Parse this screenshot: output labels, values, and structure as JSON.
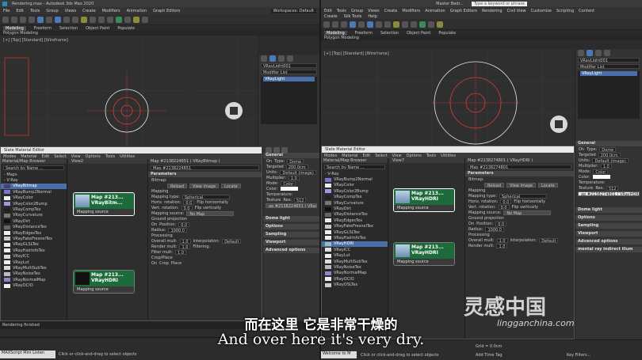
{
  "left": {
    "title": "Rendering.max - Autodesk 3ds Max 2020",
    "menu": [
      "File",
      "Edit",
      "Tools",
      "Group",
      "Views",
      "Create",
      "Modifiers",
      "Animation",
      "Graph Editors"
    ],
    "workspace": "Workspaces: Default",
    "tabs": [
      "Modeling",
      "Freeform",
      "Selection",
      "Object Paint",
      "Populate"
    ],
    "subtab": "Polygon Modeling",
    "viewport_label": "[+] [Top] [Standard] [Wireframe]",
    "cmd": {
      "name": "VRayLight001",
      "modifier_list": "Modifier List",
      "stack_item": "VRayLight"
    },
    "sme": {
      "title": "Slate Material Editor",
      "menu": [
        "Modes",
        "Material",
        "Edit",
        "Select",
        "View",
        "Options",
        "Tools",
        "Utilities"
      ],
      "browser_title": "Material/Map Browser",
      "search": "Search by Name ...",
      "group_maps": "- Maps",
      "group_vray": "- V-Ray",
      "items": [
        "VRayBitmap",
        "VRayBump2Normal",
        "VRayColor",
        "VRayColor2Bump",
        "VRayCompTex",
        "VRayCurvature",
        "VRayDirt",
        "VRayDistanceTex",
        "VRayEdgesTex",
        "VRayFakeFresnelTex",
        "VRayGLSLTex",
        "VRayHairInfoTex",
        "VRayICC",
        "VRayLut",
        "VRayMultiSubTex",
        "VRayNoiseTex",
        "VRayNormalMap",
        "VRayOCIO"
      ],
      "view_tab": "View1",
      "view_tab2": "View2",
      "node1": {
        "title": "Map #213...",
        "type": "VRayBitm...",
        "socket": "Mapping source"
      },
      "node2": {
        "title": "Map #213...",
        "type": "VRayHDRI",
        "socket": "Mapping source"
      },
      "param_title": "Map #2138224651  ( VRayBitmap )",
      "param_sub": "Map #2138224651",
      "sections": {
        "parameters": "Parameters",
        "bitmap": "Bitmap:",
        "reload": "Reload",
        "view_image": "View image",
        "locate": "Locate",
        "mapping": "Mapping",
        "mapping_type": "Mapping type:",
        "spherical": "Spherical",
        "horiz": "Horiz. rotation:",
        "vert": "Vert. rotation:",
        "flip_h": "Flip horizontally",
        "flip_v": "Flip vertically",
        "mapping_source": "Mapping source:",
        "no_map": "No Map",
        "ground": "Ground projection",
        "on": "On",
        "position": "Position:",
        "radius": "Radius:",
        "radius_val": "1000.0",
        "processing": "Processing",
        "overall": "Overall mult:",
        "render": "Render mult:",
        "interp": "Interpolation:",
        "default": "Default",
        "filter": "Filter mult:",
        "filtering": "Filtering:",
        "crop": "Crop/Place",
        "crop_opt": "Crop",
        "place_opt": "Place",
        "zero": "0.0",
        "one": "1.0"
      }
    },
    "light_panel": {
      "general": "General",
      "on": "On",
      "type_label": "Type:",
      "type": "Dome",
      "targeted": "Targeted",
      "length": "200.0cm",
      "units": "Units:",
      "units_val": "Default (image)",
      "multiplier": "Multiplier:",
      "multiplier_val": "1.0",
      "mode": "Mode:",
      "mode_val": "Color",
      "color": "Color:",
      "temperature": "Temperature:",
      "texture": "Texture",
      "res": "Res:",
      "res_val": "512",
      "texmap": "ap #2138224651 ( VRayBitmap )",
      "dome_light": "Dome light",
      "options": "Options",
      "sampling": "Sampling",
      "viewport": "Viewport",
      "advanced": "Advanced options"
    },
    "status": "Rendering finished",
    "maxscript": "MAXScript Mini Listen",
    "hint": "Click or click-and-drag to select objects",
    "zoom": "122%"
  },
  "right": {
    "title": "Master Bedr...",
    "search": "Type a keyword or phrase",
    "menu": [
      "Edit",
      "Tools",
      "Group",
      "Views",
      "Create",
      "Modifiers",
      "Animation",
      "Graph Editors",
      "Rendering",
      "Civil View",
      "Customize",
      "Scripting",
      "Content"
    ],
    "menu2": [
      "Create",
      "Silk Tools",
      "Help"
    ],
    "tabs": [
      "Modeling",
      "Freeform",
      "Selection",
      "Object Paint",
      "Populate"
    ],
    "subtab": "Polygon Modeling",
    "viewport_label": "[+] [Top] [Standard] [Wireframe]",
    "cmd": {
      "name": "VRayLight001",
      "modifier_list": "Modifier List",
      "stack_item": "VRayLight"
    },
    "sme": {
      "title": "Slate Material Editor",
      "menu": [
        "Modes",
        "Material",
        "Edit",
        "Select",
        "View",
        "Options",
        "Tools",
        "Utilities"
      ],
      "browser_title": "Material/Map Browser",
      "search": "Search by Name ...",
      "group_vray": "- V-Ray",
      "items": [
        "VRayBump2Normal",
        "VRayColor",
        "VRayColor2Bump",
        "VRayCompTex",
        "VRayCurvature",
        "VRayDirt",
        "VRayDistanceTex",
        "VRayEdgesTex",
        "VRayFakeFresnelTex",
        "VRayGLSLTex",
        "VRayHairInfoTex",
        "VRayHDRI",
        "VRayICC",
        "VRayLut",
        "VRayMultiSubTex",
        "VRayNoiseTex",
        "VRayNormalMap",
        "VRayOCIO",
        "VRayOSLTex"
      ],
      "view_tab": "View7",
      "view_tab2": "View1",
      "node1": {
        "title": "Map #213...",
        "type": "VRayHDRI",
        "socket": "Mapping source"
      },
      "node2": {
        "title": "Map #213...",
        "type": "VRayHDRI",
        "socket": "Mapping source"
      },
      "param_title": "Map #2138274801  ( VRayHDRI )",
      "param_sub": "Map #2138274801"
    },
    "light_panel": {
      "name": "VRayLight001",
      "general": "General",
      "on": "On",
      "type": "Dome",
      "targeted": "Targeted",
      "length": "200.0cm",
      "units_val": "Default (image)",
      "multiplier_val": "1.0",
      "mode_val": "Color",
      "texmap": "ap #2138274801 ( VRayHDRI )",
      "dome_light": "Dome light",
      "options": "Options",
      "sampling": "Sampling",
      "viewport": "Viewport",
      "advanced": "Advanced options",
      "indirect": "mental ray indirect illum"
    },
    "welcome": "Welcome to M",
    "hint": "Click or click-and-drag to select objects",
    "add_time_tag": "Add Time Tag",
    "grid": "Grid = 0.0cm",
    "key_filters": "Key Filters..."
  },
  "subtitle": {
    "cn": "而在这里 它是非常干燥的",
    "en": "And over here it's very dry."
  },
  "watermark": {
    "cn": "灵感中国",
    "en": "lingganchina.com"
  },
  "colors": {
    "node_header": "#1d6a3b",
    "selection": "#4a6ea9",
    "circle": "#e03c3c",
    "dome": "#d8d8d8"
  }
}
